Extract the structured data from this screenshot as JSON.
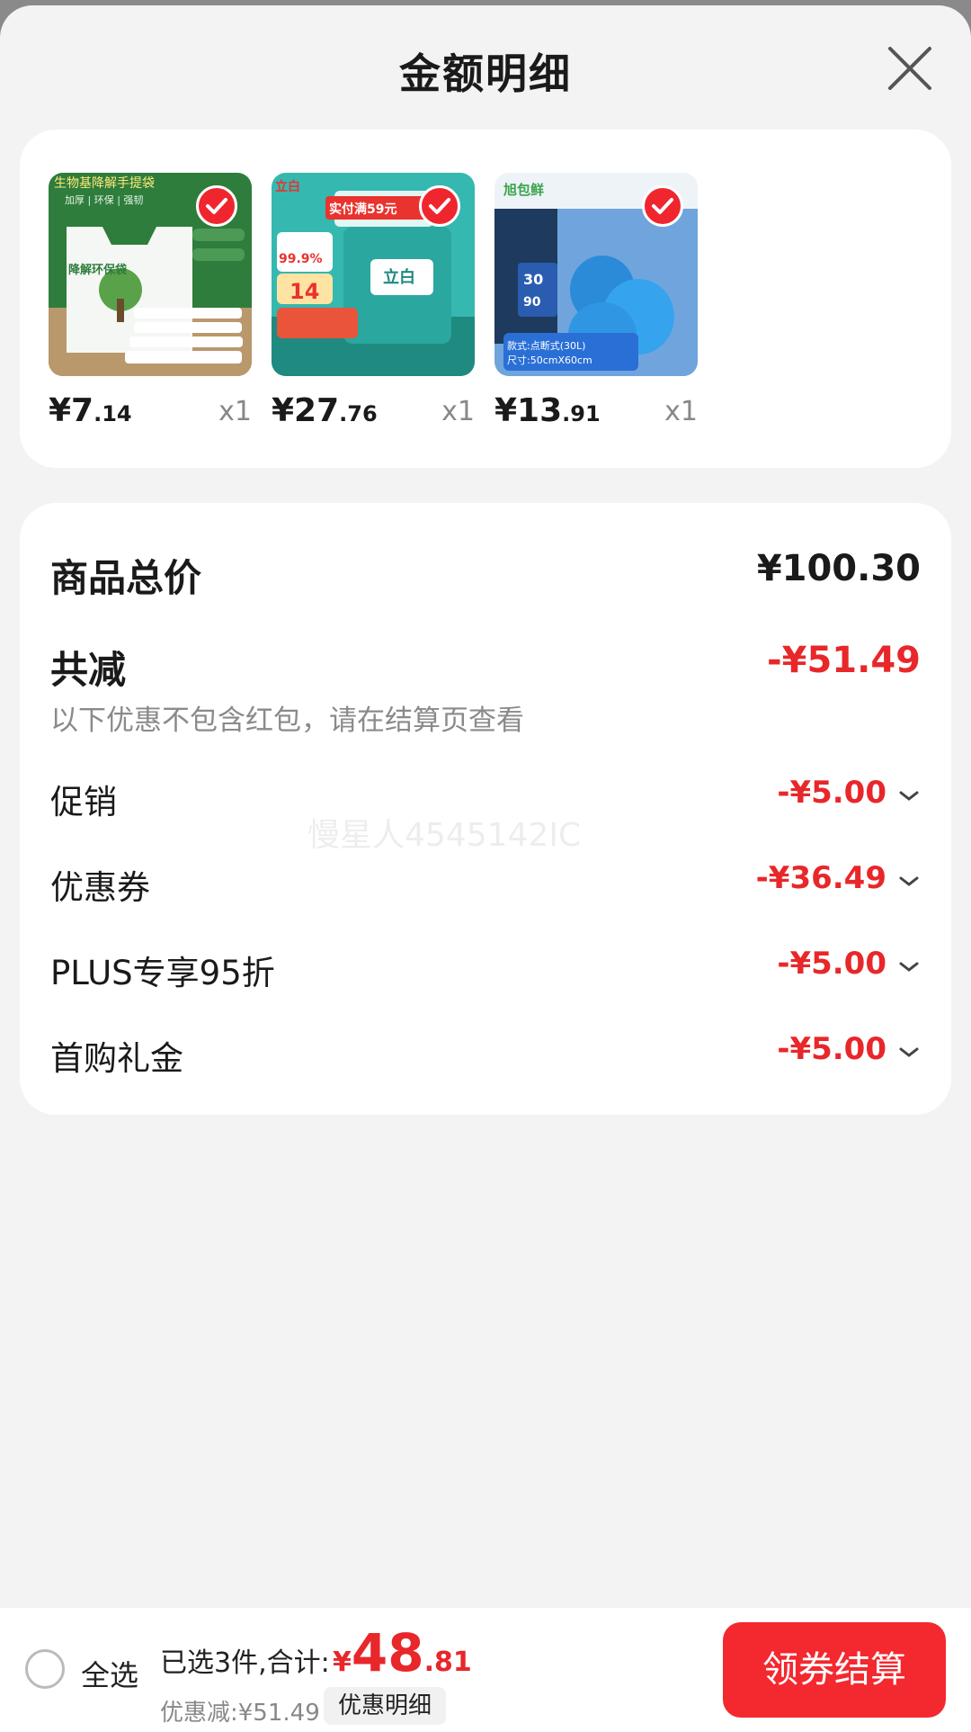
{
  "header": {
    "title": "金额明细"
  },
  "products": [
    {
      "name": "bio-bag",
      "price_int": "¥7",
      "price_dec": ".14",
      "qty": "x1"
    },
    {
      "name": "detergent",
      "price_int": "¥27",
      "price_dec": ".76",
      "qty": "x1"
    },
    {
      "name": "garbage-bag",
      "price_int": "¥13",
      "price_dec": ".91",
      "qty": "x1"
    }
  ],
  "product_labels": {
    "p1_top": "生物基降解手提袋",
    "p1_sub": "加厚 | 环保 | 强韧",
    "p1_tree": "降解环保袋",
    "p2_brand": "立白",
    "p2_banner": "实付满59元",
    "p2_pct": "99.9%",
    "p2_num": "14",
    "p3_brand": "旭包鲜",
    "p3_size": "30",
    "p3_count": "90",
    "p3_spec1": "款式:点断式(30L)",
    "p3_spec2": "尺寸:50cmX60cm"
  },
  "summary": {
    "total_label": "商品总价",
    "total_value": "¥100.30",
    "reduce_label": "共减",
    "reduce_value": "-¥51.49",
    "note": "以下优惠不包含红包，请在结算页查看",
    "watermark": "慢星人4545142IC",
    "items": [
      {
        "label": "促销",
        "value": "-¥5.00"
      },
      {
        "label": "优惠券",
        "value": "-¥36.49"
      },
      {
        "label": "PLUS专享95折",
        "value": "-¥5.00"
      },
      {
        "label": "首购礼金",
        "value": "-¥5.00"
      }
    ]
  },
  "footer": {
    "select_all": "全选",
    "selected_info": "已选3件,合计:",
    "total_sym": "¥",
    "total_int": "48",
    "total_dec": ".81",
    "discount_info": "优惠减:¥51.49",
    "detail_chip": "优惠明细",
    "checkout": "领券结算"
  },
  "colors": {
    "accent": "#e8272a",
    "button": "#f4282f"
  }
}
